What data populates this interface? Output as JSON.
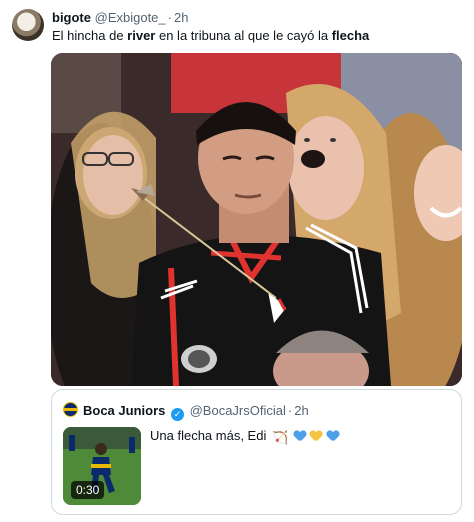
{
  "tweet": {
    "author_name": "bigote",
    "author_handle": "@Exbigote_",
    "separator": "·",
    "time": "2h",
    "text_parts": [
      {
        "text": "El hincha de ",
        "bold": false
      },
      {
        "text": "river",
        "bold": true
      },
      {
        "text": " en la tribuna al que le cayó la ",
        "bold": false
      },
      {
        "text": "flecha",
        "bold": true
      }
    ]
  },
  "quote": {
    "author_name": "Boca Juniors",
    "verified_mark": "✓",
    "author_handle": "@BocaJrsOficial",
    "separator": "·",
    "time": "2h",
    "text": "Una flecha más, Edi",
    "emojis": [
      "bow-and-arrow-icon",
      "blue-heart-icon",
      "yellow-heart-icon",
      "blue-heart-icon"
    ],
    "heart_colors": [
      "#4f9ee8",
      "#f4c542",
      "#4f9ee8"
    ],
    "video_duration": "0:30"
  },
  "colors": {
    "text_primary": "#0f1419",
    "text_secondary": "#536471",
    "border": "#cfd9de",
    "verified": "#1d9bf0",
    "boca_blue": "#0a2a6b",
    "boca_gold": "#e7b800"
  }
}
